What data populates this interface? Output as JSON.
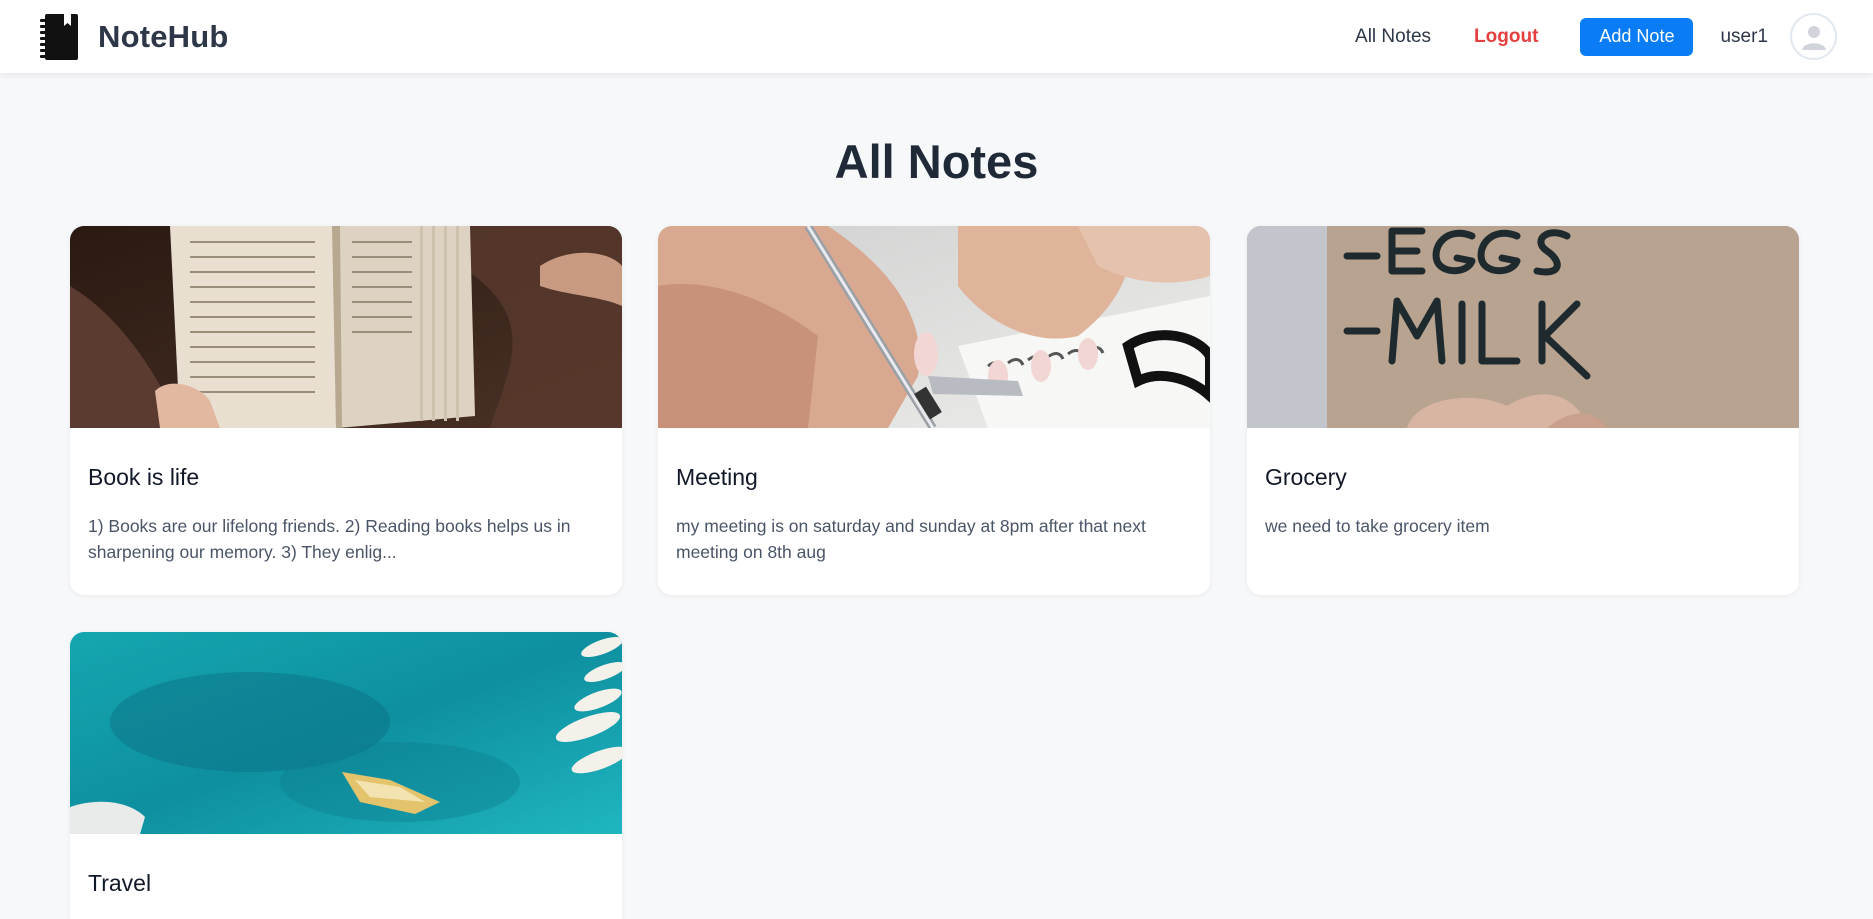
{
  "app": {
    "name": "NoteHub",
    "logo_icon": "notebook-icon"
  },
  "nav": {
    "all_notes": "All Notes",
    "logout": "Logout",
    "add_note": "Add Note",
    "username": "user1",
    "avatar_icon": "user-avatar-icon"
  },
  "colors": {
    "primary": "#0a7cf5",
    "logout": "#e53e3e",
    "background": "#f7f8fa"
  },
  "page": {
    "title": "All Notes"
  },
  "notes": [
    {
      "title": "Book is life",
      "text": "1) Books are our lifelong friends. 2) Reading books helps us in sharpening our memory. 3) They enlig...",
      "image": "open-book-photo"
    },
    {
      "title": "Meeting",
      "text": "my meeting is on saturday and sunday at 8pm after that next meeting on 8th aug",
      "image": "writing-notebook-photo"
    },
    {
      "title": "Grocery",
      "text": "we need to take grocery item",
      "image": "grocery-list-photo"
    },
    {
      "title": "Travel",
      "text": "",
      "image": "sea-boats-photo"
    }
  ]
}
